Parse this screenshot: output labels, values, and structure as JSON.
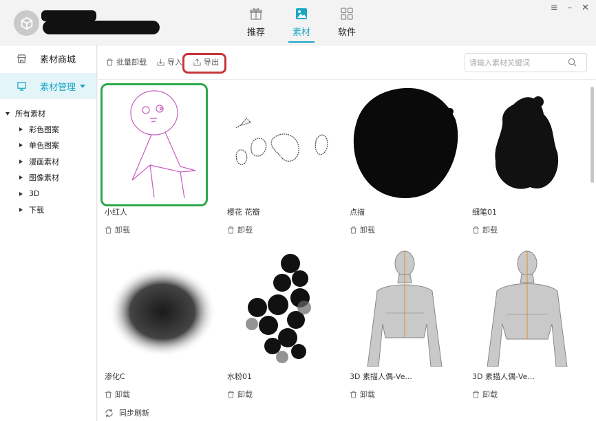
{
  "header": {
    "tabs": [
      {
        "label": "推荐",
        "icon": "gift-icon",
        "active": false
      },
      {
        "label": "素材",
        "icon": "material-icon",
        "active": true
      },
      {
        "label": "软件",
        "icon": "apps-grid-icon",
        "active": false
      }
    ],
    "window_controls": [
      "≡",
      "–",
      "✕"
    ]
  },
  "sidebar": {
    "store_label": "素材商城",
    "manage_label": "素材管理",
    "tree": {
      "root": "所有素材",
      "children": [
        "彩色图案",
        "单色图案",
        "漫画素材",
        "图像素材",
        "3D",
        "下载"
      ]
    }
  },
  "toolbar": {
    "batch_uninstall": "批量卸载",
    "import": "导入",
    "export": "导出",
    "search_placeholder": "请输入素材关键词"
  },
  "materials": [
    {
      "title": "小红人",
      "action": "卸载"
    },
    {
      "title": "樱花 花瓣",
      "action": "卸载"
    },
    {
      "title": "点描",
      "action": "卸载"
    },
    {
      "title": "细笔01",
      "action": "卸载"
    },
    {
      "title": "渗化C",
      "action": "卸载"
    },
    {
      "title": "水粉01",
      "action": "卸载"
    },
    {
      "title": "3D 素描人偶-Ve...",
      "action": "卸载"
    },
    {
      "title": "3D 素描人偶-Ve...",
      "action": "卸载"
    }
  ],
  "footer": {
    "sync_label": "同步刷新"
  },
  "colors": {
    "accent": "#1aa7c5",
    "highlight_export": "#c8353b",
    "highlight_selected": "#2aa84a"
  }
}
